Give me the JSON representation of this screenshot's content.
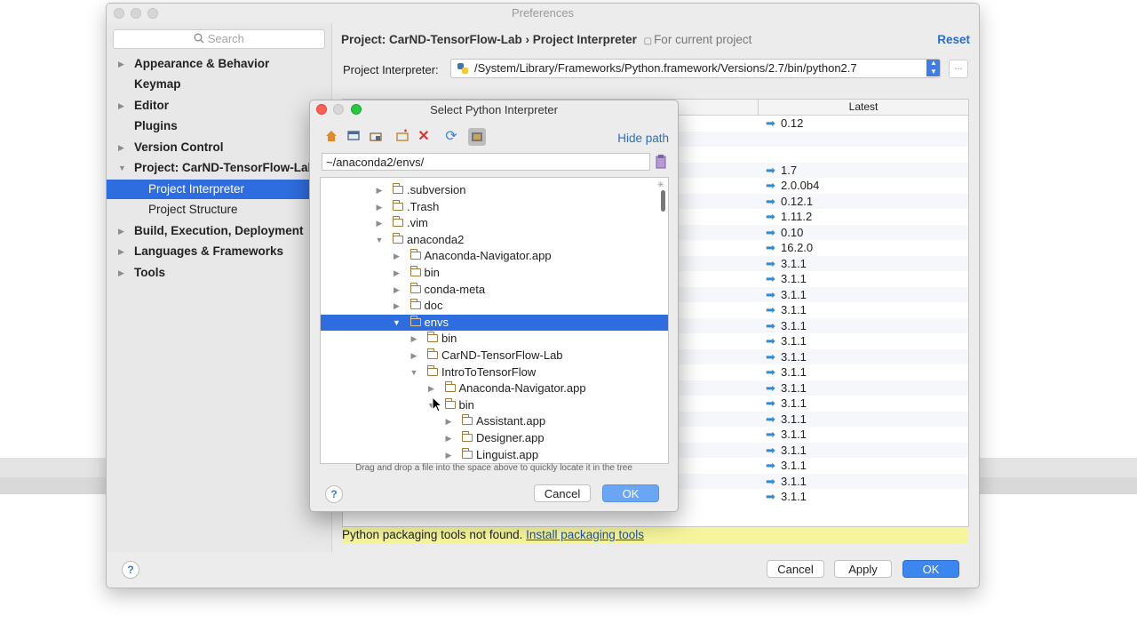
{
  "preferences": {
    "title": "Preferences",
    "search_placeholder": "Search",
    "nav": [
      {
        "label": "Appearance & Behavior",
        "arrow": "▶"
      },
      {
        "label": "Keymap",
        "arrow": ""
      },
      {
        "label": "Editor",
        "arrow": "▶"
      },
      {
        "label": "Plugins",
        "arrow": ""
      },
      {
        "label": "Version Control",
        "arrow": "▶"
      },
      {
        "label": "Project: CarND-TensorFlow-Lab",
        "arrow": "▼"
      },
      {
        "label": "Project Interpreter",
        "arrow": ""
      },
      {
        "label": "Project Structure",
        "arrow": ""
      },
      {
        "label": "Build, Execution, Deployment",
        "arrow": "▶"
      },
      {
        "label": "Languages & Frameworks",
        "arrow": "▶"
      },
      {
        "label": "Tools",
        "arrow": "▶"
      }
    ],
    "breadcrumb_project": "Project: CarND-TensorFlow-Lab",
    "breadcrumb_sep": "›",
    "breadcrumb_page": "Project Interpreter",
    "breadcrumb_scope": "For current project",
    "reset": "Reset",
    "interpreter_label": "Project Interpreter:",
    "interpreter_value": "/System/Library/Frameworks/Python.framework/Versions/2.7/bin/python2.7",
    "more_button": "...",
    "table_header_latest": "Latest",
    "latest_versions": [
      "0.12",
      "",
      "",
      "1.7",
      "2.0.0b4",
      "0.12.1",
      "1.11.2",
      "0.10",
      "16.2.0",
      "3.1.1",
      "3.1.1",
      "3.1.1",
      "3.1.1",
      "3.1.1",
      "3.1.1",
      "3.1.1",
      "3.1.1",
      "3.1.1",
      "3.1.1",
      "3.1.1",
      "3.1.1",
      "3.1.1",
      "3.1.1",
      "3.1.1",
      "3.1.1"
    ],
    "warning_text": "Python packaging tools not found.",
    "warning_link": "Install packaging tools",
    "help": "?",
    "cancel": "Cancel",
    "apply": "Apply",
    "ok": "OK"
  },
  "dialog": {
    "title": "Select Python Interpreter",
    "hide_path": "Hide path",
    "path": "~/anaconda2/envs/",
    "tree": [
      {
        "label": ".subversion",
        "depth": 0,
        "expanded": false
      },
      {
        "label": ".Trash",
        "depth": 0,
        "expanded": false
      },
      {
        "label": ".vim",
        "depth": 0,
        "expanded": false
      },
      {
        "label": "anaconda2",
        "depth": 0,
        "expanded": true
      },
      {
        "label": "Anaconda-Navigator.app",
        "depth": 1,
        "expanded": false
      },
      {
        "label": "bin",
        "depth": 1,
        "expanded": false
      },
      {
        "label": "conda-meta",
        "depth": 1,
        "expanded": false
      },
      {
        "label": "doc",
        "depth": 1,
        "expanded": false
      },
      {
        "label": "envs",
        "depth": 1,
        "expanded": true,
        "selected": true
      },
      {
        "label": "bin",
        "depth": 2,
        "expanded": false
      },
      {
        "label": "CarND-TensorFlow-Lab",
        "depth": 2,
        "expanded": false
      },
      {
        "label": "IntroToTensorFlow",
        "depth": 2,
        "expanded": true
      },
      {
        "label": "Anaconda-Navigator.app",
        "depth": 3,
        "expanded": false
      },
      {
        "label": "bin",
        "depth": 3,
        "expanded": true
      },
      {
        "label": "Assistant.app",
        "depth": 4,
        "expanded": false
      },
      {
        "label": "Designer.app",
        "depth": 4,
        "expanded": false
      },
      {
        "label": "Linguist.app",
        "depth": 4,
        "expanded": false
      }
    ],
    "hint": "Drag and drop a file into the space above to quickly locate it in the tree",
    "help": "?",
    "cancel": "Cancel",
    "ok": "OK",
    "colors": {
      "selection": "#2e6ddf",
      "accent": "#3c86ef",
      "close": "#fc5f57",
      "minimize": "#fdbc2e",
      "zoom": "#28c840"
    }
  }
}
